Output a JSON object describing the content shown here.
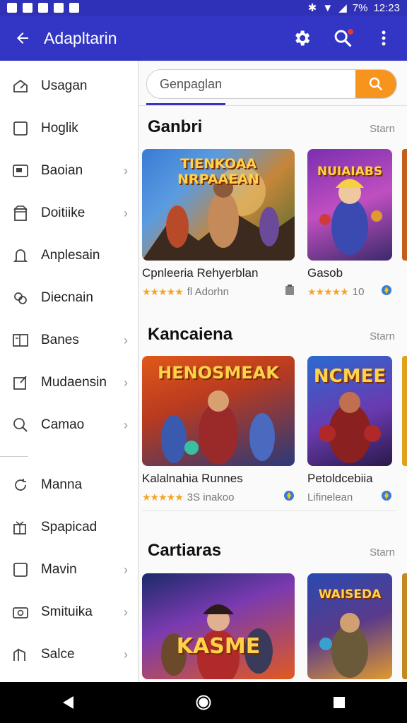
{
  "status": {
    "battery": "7%",
    "time": "12:23"
  },
  "appbar": {
    "title": "Adapltarin"
  },
  "search": {
    "placeholder": "Genpaglan"
  },
  "drawer": {
    "items": [
      {
        "label": "Usagan",
        "icon": "home-edit-icon",
        "chevron": false
      },
      {
        "label": "Hoglik",
        "icon": "square-icon",
        "chevron": false
      },
      {
        "label": "Baoian",
        "icon": "card-icon",
        "chevron": true
      },
      {
        "label": "Doitiike",
        "icon": "box-icon",
        "chevron": true
      },
      {
        "label": "Anplesain",
        "icon": "bell-icon",
        "chevron": false
      },
      {
        "label": "Diecnain",
        "icon": "link-icon",
        "chevron": false
      },
      {
        "label": "Banes",
        "icon": "panel-icon",
        "chevron": true
      },
      {
        "label": "Mudaensin",
        "icon": "edit-box-icon",
        "chevron": true
      },
      {
        "label": "Camao",
        "icon": "search-icon",
        "chevron": true
      },
      {
        "label": "Manna",
        "icon": "refresh-icon",
        "chevron": false
      },
      {
        "label": "Spapicad",
        "icon": "gift-icon",
        "chevron": false
      },
      {
        "label": "Mavin",
        "icon": "square-icon",
        "chevron": true
      },
      {
        "label": "Smituika",
        "icon": "camera-icon",
        "chevron": true
      },
      {
        "label": "Salce",
        "icon": "building-icon",
        "chevron": true
      }
    ]
  },
  "sections": [
    {
      "title": "Ganbri",
      "more": "Starn",
      "cards": [
        {
          "name": "Cpnleeria Rehyerblan",
          "rating_text": "fl Adorhn",
          "thumb_title": "TIENKOAA NRPAAEAN",
          "badge": "clipboard-icon"
        },
        {
          "name": "Gasob",
          "rating_text": "10",
          "thumb_title": "NUIAIABS",
          "badge": "shield-icon"
        }
      ]
    },
    {
      "title": "Kancaiena",
      "more": "Starn",
      "cards": [
        {
          "name": "Kalalnahia Runnes",
          "rating_text": "3S inakoo",
          "thumb_title": "HENOSMEAK",
          "badge": "shield-icon"
        },
        {
          "name": "Petoldcebiia",
          "rating_text": "Lifinelean",
          "thumb_title": "NCMEE",
          "badge": "shield-icon"
        }
      ]
    },
    {
      "title": "Cartiaras",
      "more": "Starn",
      "cards": [
        {
          "name": "",
          "rating_text": "",
          "thumb_title": "KASME",
          "badge": ""
        },
        {
          "name": "",
          "rating_text": "",
          "thumb_title": "WAISEDA",
          "badge": ""
        }
      ]
    }
  ],
  "colors": {
    "appbar": "#3336c4",
    "accent": "#f7941d",
    "star": "#f5a623"
  }
}
